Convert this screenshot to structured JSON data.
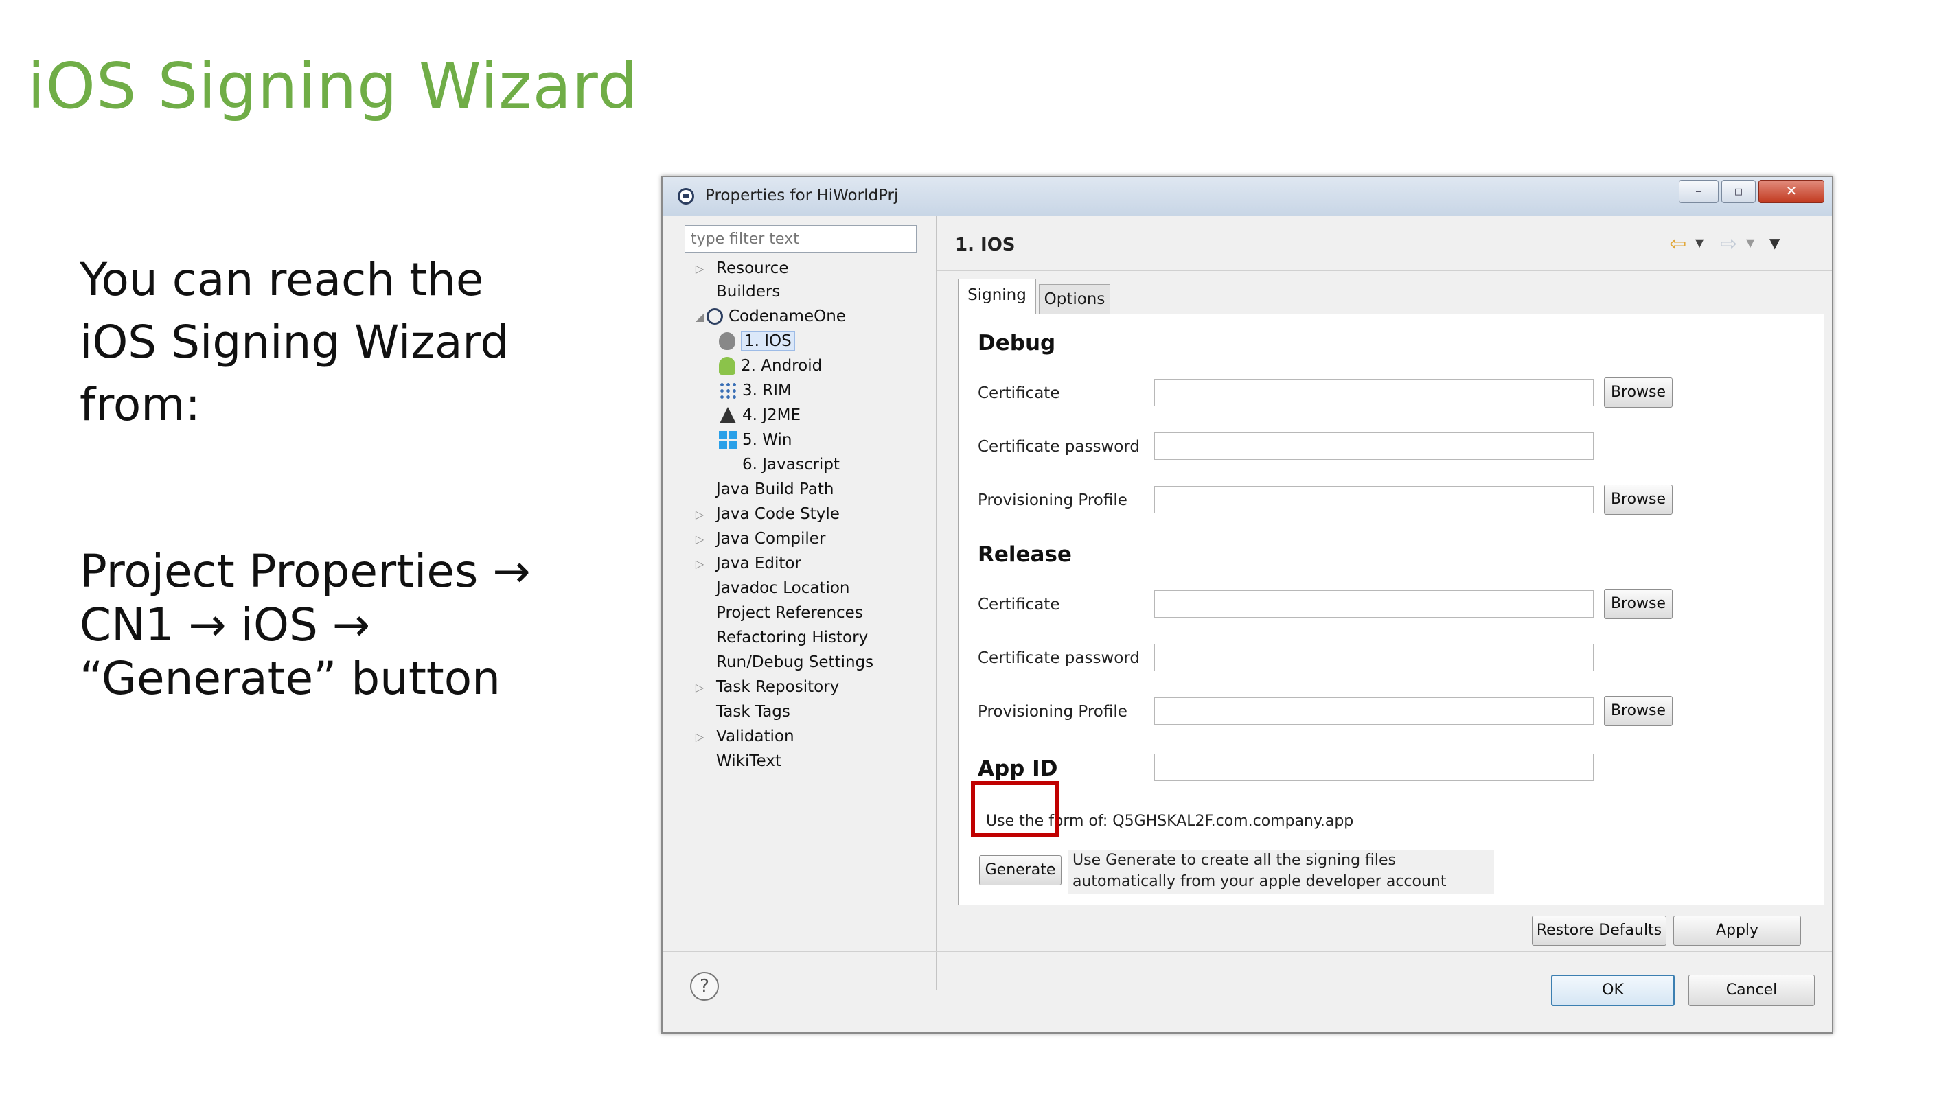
{
  "slide": {
    "title": "iOS Signing Wizard",
    "intro": "You can reach the iOS Signing Wizard from:",
    "path": "Project Properties → CN1 → iOS → “Generate” button"
  },
  "dialog": {
    "title": "Properties for HiWorldPrj",
    "filter_placeholder": "type filter text",
    "tree": [
      {
        "label": "Resource"
      },
      {
        "label": "Builders"
      },
      {
        "label": "CodenameOne"
      },
      {
        "label": "1. IOS"
      },
      {
        "label": "2. Android"
      },
      {
        "label": "3. RIM"
      },
      {
        "label": "4. J2ME"
      },
      {
        "label": "5. Win"
      },
      {
        "label": "6. Javascript"
      },
      {
        "label": "Java Build Path"
      },
      {
        "label": "Java Code Style"
      },
      {
        "label": "Java Compiler"
      },
      {
        "label": "Java Editor"
      },
      {
        "label": "Javadoc Location"
      },
      {
        "label": "Project References"
      },
      {
        "label": "Refactoring History"
      },
      {
        "label": "Run/Debug Settings"
      },
      {
        "label": "Task Repository"
      },
      {
        "label": "Task Tags"
      },
      {
        "label": "Validation"
      },
      {
        "label": "WikiText"
      }
    ],
    "page_title": "1. IOS",
    "tabs": [
      {
        "label": "Signing"
      },
      {
        "label": "Options"
      }
    ],
    "debug": {
      "heading": "Debug",
      "certificate_label": "Certificate",
      "certificate_password_label": "Certificate password",
      "provisioning_profile_label": "Provisioning Profile"
    },
    "release": {
      "heading": "Release",
      "certificate_label": "Certificate",
      "certificate_password_label": "Certificate password",
      "provisioning_profile_label": "Provisioning Profile"
    },
    "browse_label": "Browse",
    "app_id": {
      "heading": "App ID",
      "hint": "Use the form of: Q5GHSKAL2F.com.company.app"
    },
    "generate": {
      "label": "Generate",
      "description": "Use Generate to create all the signing files automatically from your apple developer account"
    },
    "buttons": {
      "restore_defaults": "Restore Defaults",
      "apply": "Apply",
      "ok": "OK",
      "cancel": "Cancel"
    },
    "highlight_color": "#c00000",
    "accent_color": "#70ad47"
  }
}
